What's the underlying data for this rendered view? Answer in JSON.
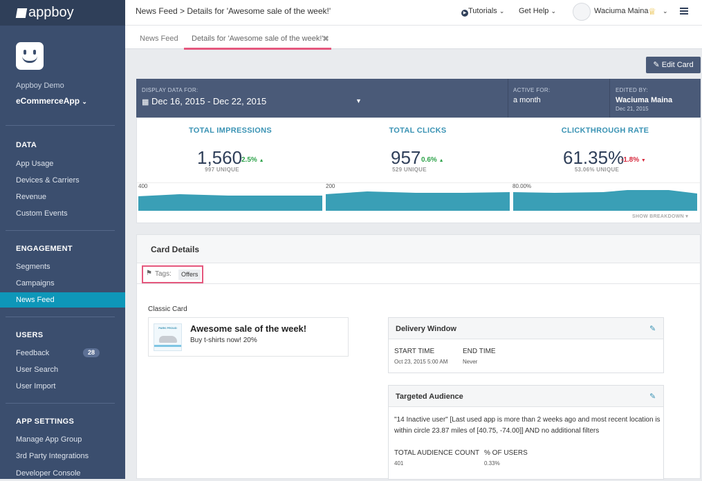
{
  "sidebar": {
    "logo_text": "appboy",
    "demo_label": "Appboy Demo",
    "app_name": "eCommerceApp",
    "sections": [
      {
        "title": "DATA",
        "items": [
          "App Usage",
          "Devices & Carriers",
          "Revenue",
          "Custom Events"
        ]
      },
      {
        "title": "ENGAGEMENT",
        "items": [
          "Segments",
          "Campaigns",
          "News Feed"
        ]
      },
      {
        "title": "USERS",
        "items": [
          "Feedback",
          "User Search",
          "User Import"
        ]
      },
      {
        "title": "APP SETTINGS",
        "items": [
          "Manage App Group",
          "3rd Party Integrations",
          "Developer Console"
        ]
      }
    ],
    "active_item": "News Feed",
    "feedback_badge": "28"
  },
  "topbar": {
    "breadcrumb": "News Feed > Details for 'Awesome sale of the week!'",
    "tutorials": "Tutorials",
    "help": "Get Help",
    "user_name": "Waciuma Maina"
  },
  "tabs": [
    "News Feed",
    "Details for 'Awesome sale of the week!'"
  ],
  "edit_card_label": "Edit Card",
  "display_bar": {
    "display_label": "DISPLAY DATA FOR:",
    "date_range": "Dec 16, 2015 - Dec 22, 2015",
    "active_label": "ACTIVE FOR:",
    "active_value": "a month",
    "edited_label": "EDITED BY:",
    "edited_by": "Waciuma Maina",
    "edited_date": "Dec 21, 2015"
  },
  "stats": [
    {
      "title": "TOTAL IMPRESSIONS",
      "value": "1,560",
      "delta": "2.5%",
      "direction": "up",
      "unique": "997 UNIQUE",
      "axis_max": "400"
    },
    {
      "title": "TOTAL CLICKS",
      "value": "957",
      "delta": "0.6%",
      "direction": "up",
      "unique": "529 UNIQUE",
      "axis_max": "200"
    },
    {
      "title": "CLICKTHROUGH RATE",
      "value": "61.35%",
      "delta": "-1.8%",
      "direction": "down",
      "unique": "53.06% UNIQUE",
      "axis_max": "80.00%"
    }
  ],
  "show_breakdown": "SHOW BREAKDOWN",
  "colors": {
    "sparkline": "#3a9fb6",
    "up": "#2ea34a",
    "down": "#d7283c",
    "accent": "#e5577d"
  },
  "card_details": {
    "title": "Card Details",
    "tags_label": "Tags:",
    "tag": "Offers",
    "card_type": "Classic Card",
    "card_title": "Awesome sale of the week!",
    "card_text": "Buy t-shirts now!  20%",
    "thumb_text": "PARK PROUD"
  },
  "delivery_window": {
    "title": "Delivery Window",
    "start_label": "START TIME",
    "start_value": "Oct 23, 2015 5:00 AM",
    "end_label": "END TIME",
    "end_value": "Never"
  },
  "targeted_audience": {
    "title": "Targeted Audience",
    "description": "\"14 Inactive user\" [Last used app is more than 2 weeks ago and most recent location is within circle 23.87 miles of [40.75, -74.00]] AND no additional filters",
    "count_label": "TOTAL AUDIENCE COUNT",
    "count_value": "401",
    "pct_label": "% OF USERS",
    "pct_value": "0.33%"
  }
}
